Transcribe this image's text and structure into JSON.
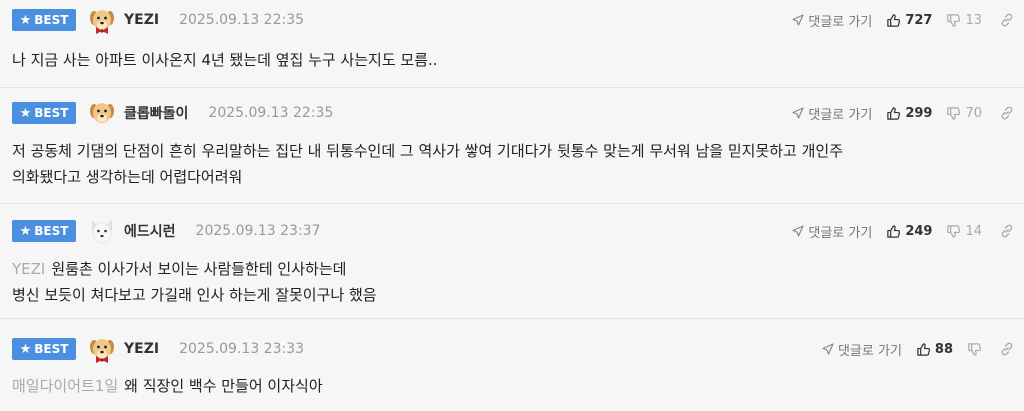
{
  "badge_label": "BEST",
  "reply_label": "댓글로 가기",
  "comments": [
    {
      "nickname": "YEZI",
      "date": "2025.09.13 22:35",
      "likes": "727",
      "dislikes": "13",
      "mention": "",
      "lines": [
        "나 지금 사는 아파트 이사온지 4년 됐는데 옆집 누구 사는지도 모름.."
      ],
      "avatar": "puppy-red-bow"
    },
    {
      "nickname": "클롭빠돌이",
      "date": "2025.09.13 22:35",
      "likes": "299",
      "dislikes": "70",
      "mention": "",
      "lines": [
        "저 공동체 기댐의 단점이 흔히 우리말하는 집단 내 뒤통수인데 그 역사가 쌓여 기대다가 뒷통수 맞는게 무서워 남을 믿지못하고 개인주",
        "의화됐다고 생각하는데 어렵다어려워"
      ],
      "avatar": "puppy"
    },
    {
      "nickname": "에드시런",
      "date": "2025.09.13 23:37",
      "likes": "249",
      "dislikes": "14",
      "mention": "YEZI",
      "lines": [
        "원룸촌 이사가서 보이는 사람들한테 인사하는데",
        "병신 보듯이 쳐다보고 가길래 인사 하는게 잘못이구나 했음"
      ],
      "avatar": "white-puppy"
    },
    {
      "nickname": "YEZI",
      "date": "2025.09.13 23:33",
      "likes": "88",
      "dislikes": "",
      "mention": "매일다이어트1일",
      "lines": [
        "왜 직장인 백수 만들어 이자식아"
      ],
      "avatar": "puppy-red-bow"
    }
  ],
  "colors": {
    "badge": "#4a8fe0",
    "background": "#f6f6f6"
  }
}
